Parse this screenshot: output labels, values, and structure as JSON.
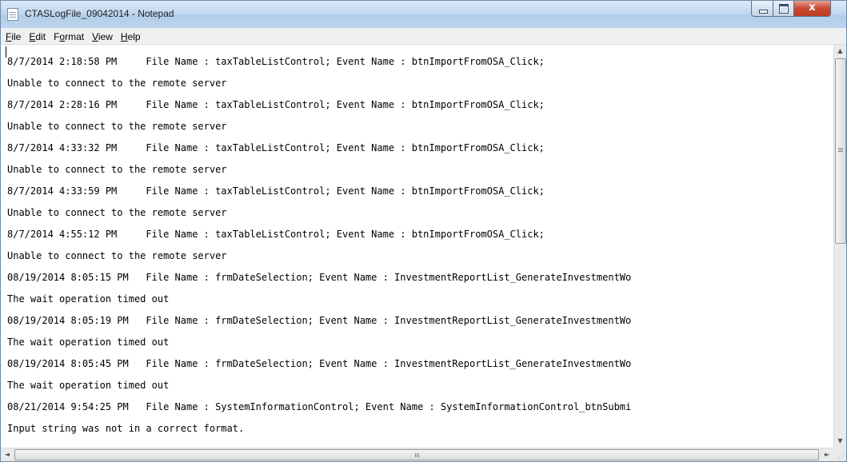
{
  "window": {
    "title": "CTASLogFile_09042014 - Notepad",
    "icon": "notepad-icon",
    "controls": {
      "minimize": "minimize-icon",
      "maximize": "maximize-icon",
      "close": "close-icon",
      "close_glyph": "x"
    }
  },
  "menu": {
    "items": [
      {
        "label": "File",
        "accel": "F"
      },
      {
        "label": "Edit",
        "accel": "E"
      },
      {
        "label": "Format",
        "accel": "o"
      },
      {
        "label": "View",
        "accel": "V"
      },
      {
        "label": "Help",
        "accel": "H"
      }
    ]
  },
  "document": {
    "lines": [
      "8/7/2014 2:18:58 PM     File Name : taxTableListControl; Event Name : btnImportFromOSA_Click;",
      "Unable to connect to the remote server",
      "8/7/2014 2:28:16 PM     File Name : taxTableListControl; Event Name : btnImportFromOSA_Click;",
      "Unable to connect to the remote server",
      "8/7/2014 4:33:32 PM     File Name : taxTableListControl; Event Name : btnImportFromOSA_Click;",
      "Unable to connect to the remote server",
      "8/7/2014 4:33:59 PM     File Name : taxTableListControl; Event Name : btnImportFromOSA_Click;",
      "Unable to connect to the remote server",
      "8/7/2014 4:55:12 PM     File Name : taxTableListControl; Event Name : btnImportFromOSA_Click;",
      "Unable to connect to the remote server",
      "08/19/2014 8:05:15 PM   File Name : frmDateSelection; Event Name : InvestmentReportList_GenerateInvestmentWo",
      "The wait operation timed out",
      "08/19/2014 8:05:19 PM   File Name : frmDateSelection; Event Name : InvestmentReportList_GenerateInvestmentWo",
      "The wait operation timed out",
      "08/19/2014 8:05:45 PM   File Name : frmDateSelection; Event Name : InvestmentReportList_GenerateInvestmentWo",
      "The wait operation timed out",
      "08/21/2014 9:54:25 PM   File Name : SystemInformationControl; Event Name : SystemInformationControl_btnSubmi",
      "Input string was not in a correct format."
    ]
  },
  "scrollbars": {
    "vertical": {
      "up_glyph": "▲",
      "down_glyph": "▼",
      "mid_glyph": "≡",
      "position": 0.0
    },
    "horizontal": {
      "left_glyph": "◄",
      "right_glyph": "►",
      "mid_glyph": "III",
      "position": 0.0
    }
  }
}
